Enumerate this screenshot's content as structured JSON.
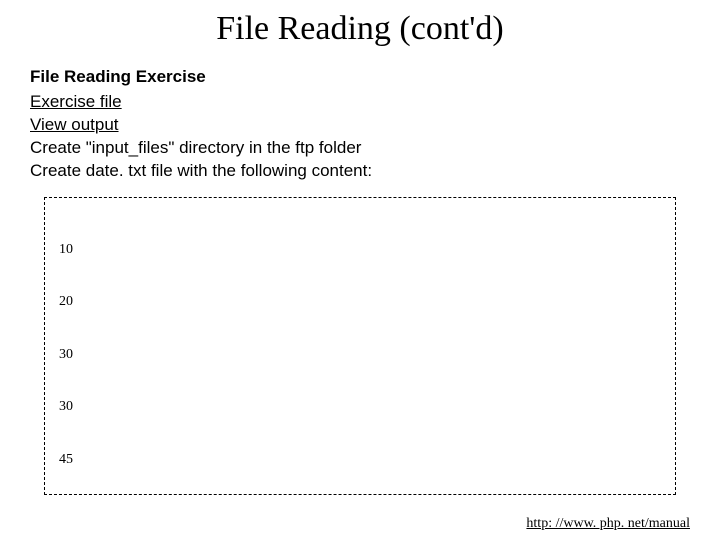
{
  "title": "File Reading (cont'd)",
  "subheading": "File Reading Exercise",
  "links": {
    "exercise_file": "Exercise file",
    "view_output": "View output"
  },
  "instructions": {
    "line1": "Create \"input_files\" directory in the ftp folder",
    "line2": "Create date. txt file with the following content:"
  },
  "code_lines": [
    "10",
    "20",
    "30",
    "30",
    "45"
  ],
  "footer_url": "http: //www. php. net/manual"
}
